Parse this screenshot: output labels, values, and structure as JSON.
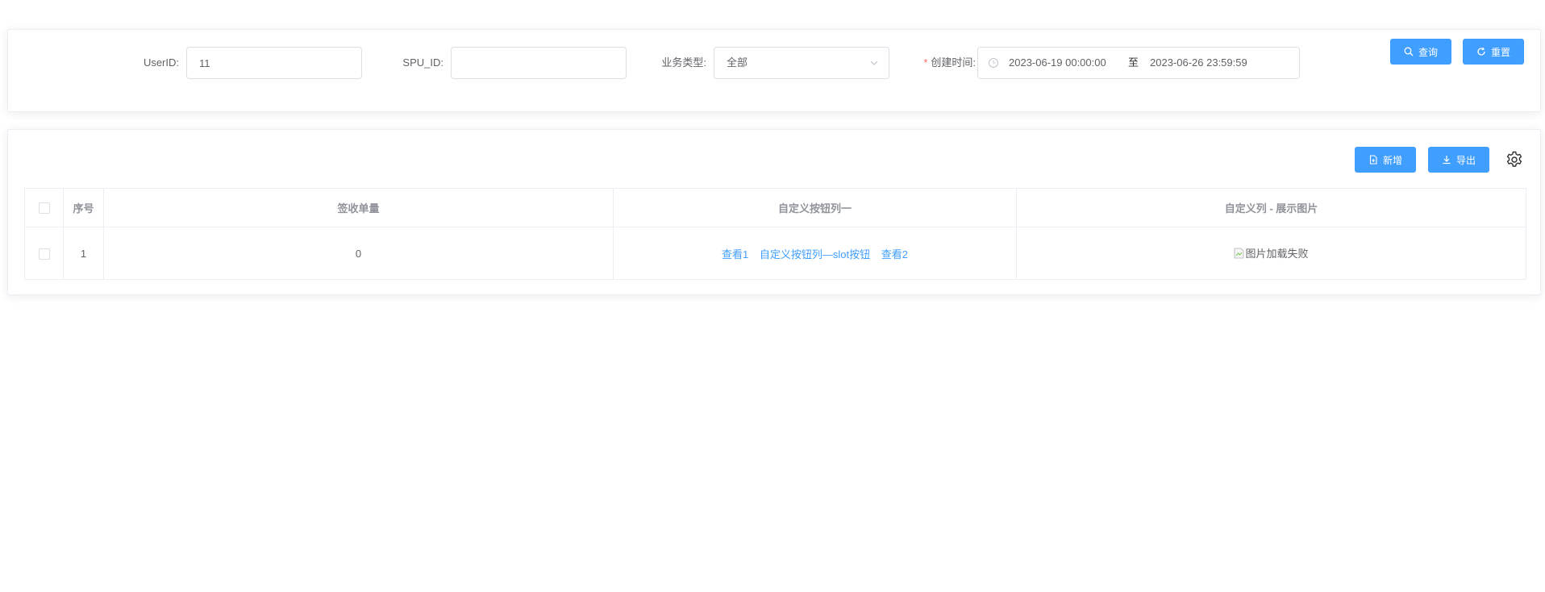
{
  "search_form": {
    "userid": {
      "label": "UserID:",
      "value": "11",
      "placeholder": ""
    },
    "spu_id": {
      "label": "SPU_ID:",
      "value": "",
      "placeholder": ""
    },
    "business_type": {
      "label": "业务类型:",
      "value": "全部"
    },
    "created_time": {
      "required_mark": "*",
      "label": "创建时间:",
      "start": "2023-06-19 00:00:00",
      "separator": "至",
      "end": "2023-06-26 23:59:59"
    },
    "query_button": "查询",
    "reset_button": "重置"
  },
  "toolbar": {
    "add_button": "新增",
    "export_button": "导出"
  },
  "table": {
    "columns": [
      "序号",
      "签收单量",
      "自定义按钮列一",
      "自定义列 - 展示图片"
    ],
    "rows": [
      {
        "index": "1",
        "signed_count": "0",
        "actions": [
          "查看1",
          "自定义按钮列—slot按钮",
          "查看2"
        ],
        "image_alt": "图片加载失败"
      }
    ]
  },
  "colors": {
    "primary": "#409eff",
    "required": "#f56c6c",
    "border": "#dcdfe6"
  }
}
